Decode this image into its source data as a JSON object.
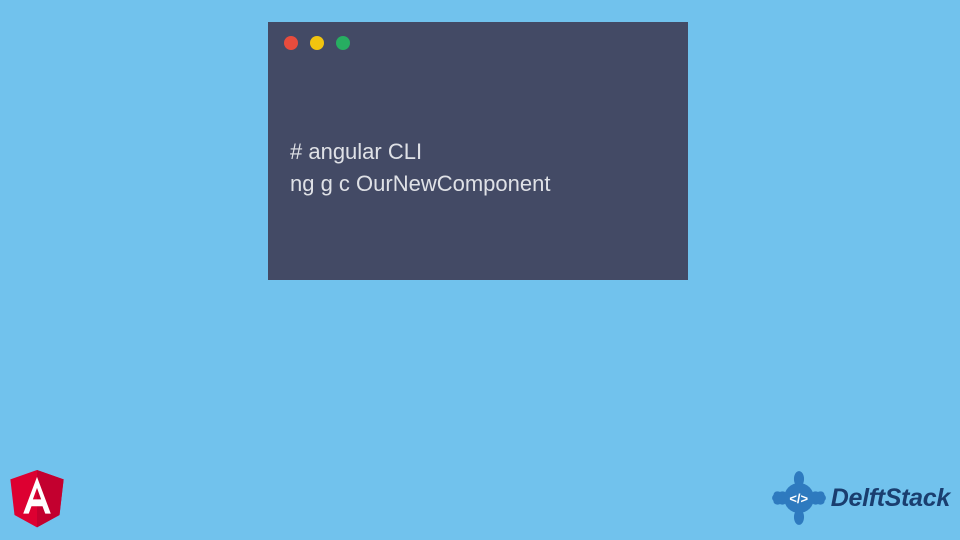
{
  "terminal": {
    "dots": {
      "red": "#e84c3d",
      "yellow": "#f1c40f",
      "green": "#27ae61"
    },
    "lines": [
      "# angular CLI",
      "ng g c OurNewComponent"
    ]
  },
  "logos": {
    "angular_letter": "A",
    "delftstack_badge_text": "</>",
    "delftstack_text": "DelftStack"
  },
  "colors": {
    "page_bg": "#71c2ed",
    "terminal_bg": "#434a65",
    "terminal_text": "#dfe1e6",
    "angular_red": "#dd0031",
    "angular_dark_red": "#c3002f",
    "delft_blue": "#2e7abf",
    "delft_text": "#1a3e6f"
  }
}
